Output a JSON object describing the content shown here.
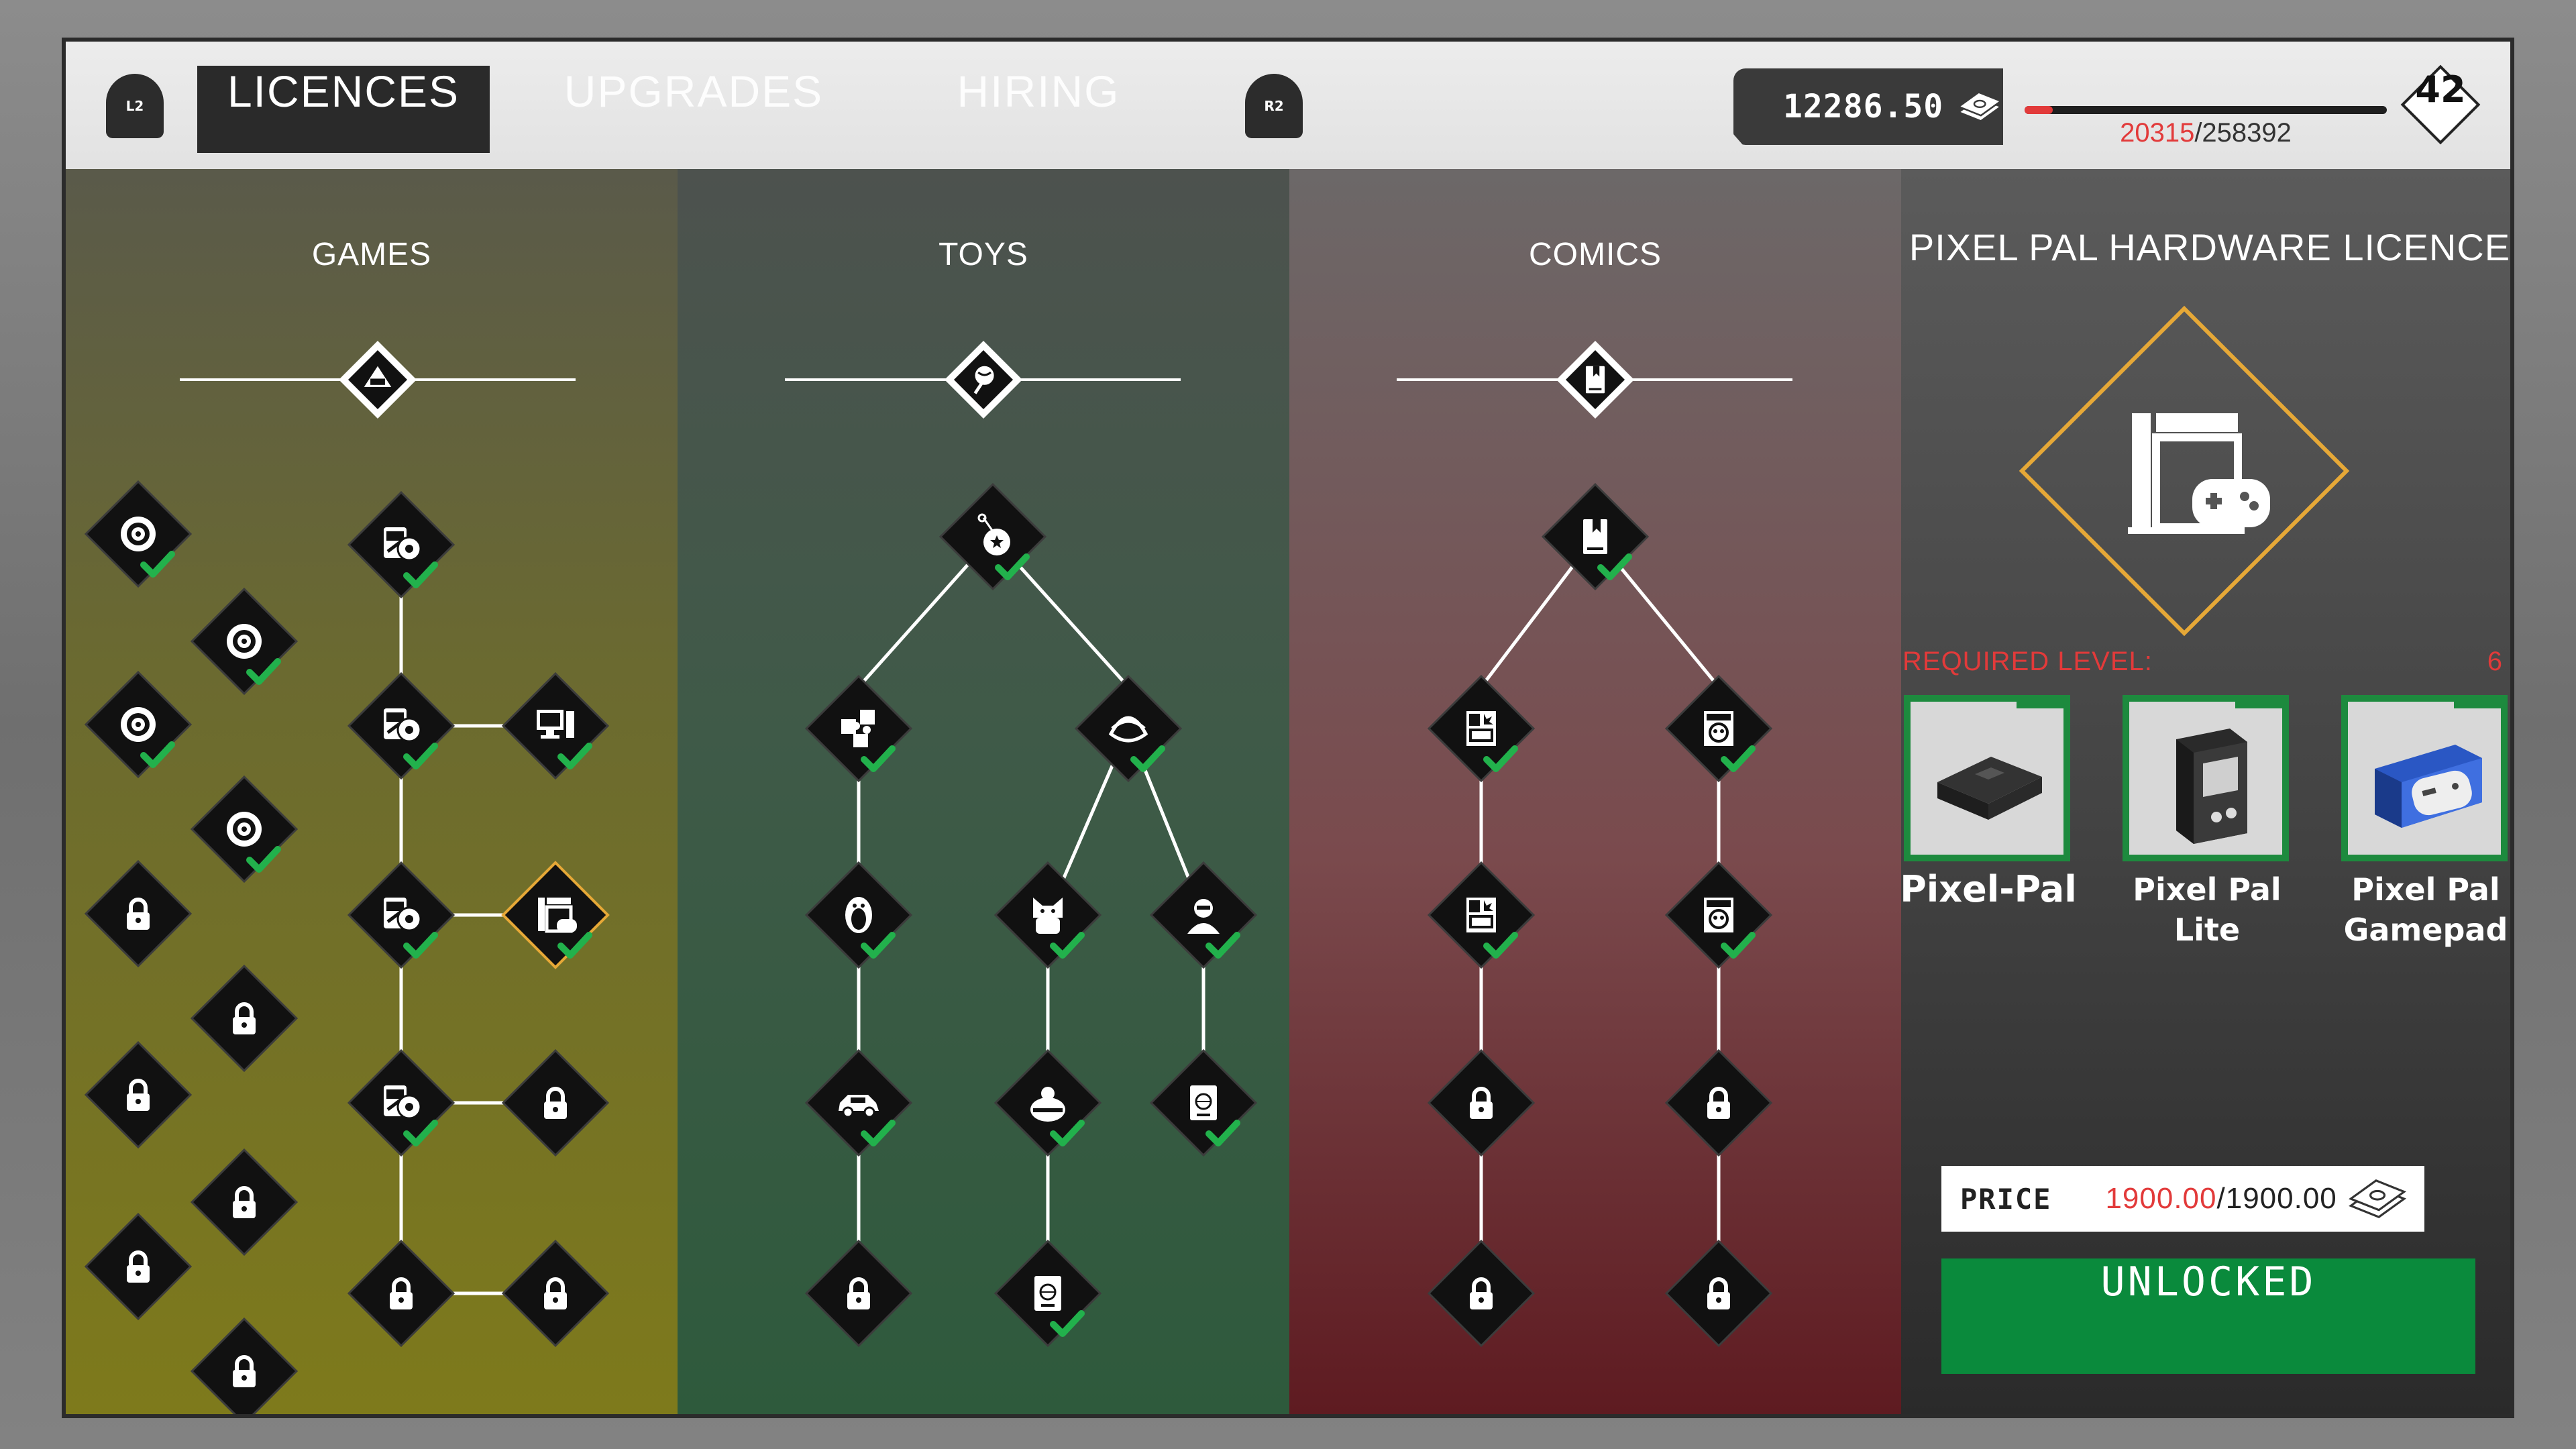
{
  "header": {
    "left_bumper": "L2",
    "right_bumper": "R2",
    "tabs": [
      {
        "label": "LICENCES",
        "active": true
      },
      {
        "label": "UPGRADES",
        "active": false
      },
      {
        "label": "HIRING",
        "active": false
      }
    ],
    "money": "12286.50",
    "xp_current": "20315",
    "xp_total": "/258392",
    "xp_fraction": 0.0786,
    "level": "42"
  },
  "columns": [
    {
      "key": "games",
      "title": "GAMES",
      "header_icon": "pixel-helmet-icon"
    },
    {
      "key": "toys",
      "title": "TOYS",
      "header_icon": "rattle-icon"
    },
    {
      "key": "comics",
      "title": "COMICS",
      "header_icon": "book-icon"
    }
  ],
  "detail": {
    "title": "PIXEL PAL HARDWARE LICENCE",
    "icon": "console-gamepad-icon",
    "required_level_label": "REQUIRED LEVEL:",
    "required_level_value": "6",
    "products": [
      {
        "name": "Pixel-Pal",
        "icon": "console-box-icon"
      },
      {
        "name": "Pixel Pal\nLite",
        "icon": "handheld-icon"
      },
      {
        "name": "Pixel Pal\nGamepad",
        "icon": "gamepad-box-icon"
      }
    ],
    "price_label": "PRICE",
    "price_current": "1900.00",
    "price_total": "/1900.00",
    "unlock_label": "UNLOCKED"
  },
  "colors": {
    "accent_red": "#e23a3a",
    "unlocked_green": "#0a8a3c",
    "check_green": "#22b14c",
    "selected_orange": "#e6a837"
  }
}
